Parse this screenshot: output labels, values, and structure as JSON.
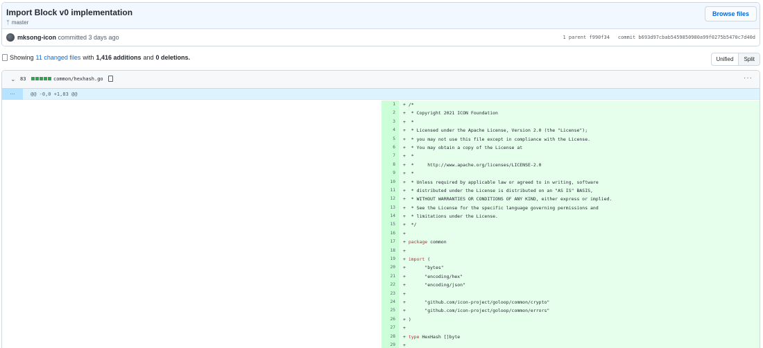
{
  "commit": {
    "title": "Import Block v0 implementation",
    "branch": "master",
    "browse_label": "Browse files",
    "author": "mksong-icon",
    "action": "committed 3 days ago",
    "parent_label": "1 parent f990f34",
    "commit_label": "commit b693d97cbab5459850980a99f0275b5470c7d40d"
  },
  "summary": {
    "prefix": "Showing",
    "changed_files": "11 changed files",
    "mid": "with",
    "additions": "1,416 additions",
    "and": "and",
    "deletions": "0 deletions."
  },
  "view_toggle": {
    "unified": "Unified",
    "split": "Split"
  },
  "file": {
    "additions_count": "83",
    "path": "common/hexhash.go",
    "more": "···",
    "hunk_expand": "...",
    "hunk_header": "@@ -0,0 +1,83 @@"
  },
  "lines": [
    {
      "n": "1",
      "t": "+ /*"
    },
    {
      "n": "2",
      "t": "+  * Copyright 2021 ICON Foundation"
    },
    {
      "n": "3",
      "t": "+  *"
    },
    {
      "n": "4",
      "t": "+  * Licensed under the Apache License, Version 2.0 (the \"License\");"
    },
    {
      "n": "5",
      "t": "+  * you may not use this file except in compliance with the License."
    },
    {
      "n": "6",
      "t": "+  * You may obtain a copy of the License at"
    },
    {
      "n": "7",
      "t": "+  *"
    },
    {
      "n": "8",
      "t": "+  *     http://www.apache.org/licenses/LICENSE-2.0"
    },
    {
      "n": "9",
      "t": "+  *"
    },
    {
      "n": "10",
      "t": "+  * Unless required by applicable law or agreed to in writing, software"
    },
    {
      "n": "11",
      "t": "+  * distributed under the License is distributed on an \"AS IS\" BASIS,"
    },
    {
      "n": "12",
      "t": "+  * WITHOUT WARRANTIES OR CONDITIONS OF ANY KIND, either express or implied."
    },
    {
      "n": "13",
      "t": "+  * See the License for the specific language governing permissions and"
    },
    {
      "n": "14",
      "t": "+  * limitations under the License."
    },
    {
      "n": "15",
      "t": "+  */"
    },
    {
      "n": "16",
      "t": "+"
    },
    {
      "n": "17",
      "t": "+ package common"
    },
    {
      "n": "18",
      "t": "+"
    },
    {
      "n": "19",
      "t": "+ import ("
    },
    {
      "n": "20",
      "t": "+       \"bytes\""
    },
    {
      "n": "21",
      "t": "+       \"encoding/hex\""
    },
    {
      "n": "22",
      "t": "+       \"encoding/json\""
    },
    {
      "n": "23",
      "t": "+"
    },
    {
      "n": "24",
      "t": "+       \"github.com/icon-project/goloop/common/crypto\""
    },
    {
      "n": "25",
      "t": "+       \"github.com/icon-project/goloop/common/errors\""
    },
    {
      "n": "26",
      "t": "+ )"
    },
    {
      "n": "27",
      "t": "+"
    },
    {
      "n": "28",
      "t": "+ type HexHash []byte"
    },
    {
      "n": "29",
      "t": "+"
    }
  ]
}
